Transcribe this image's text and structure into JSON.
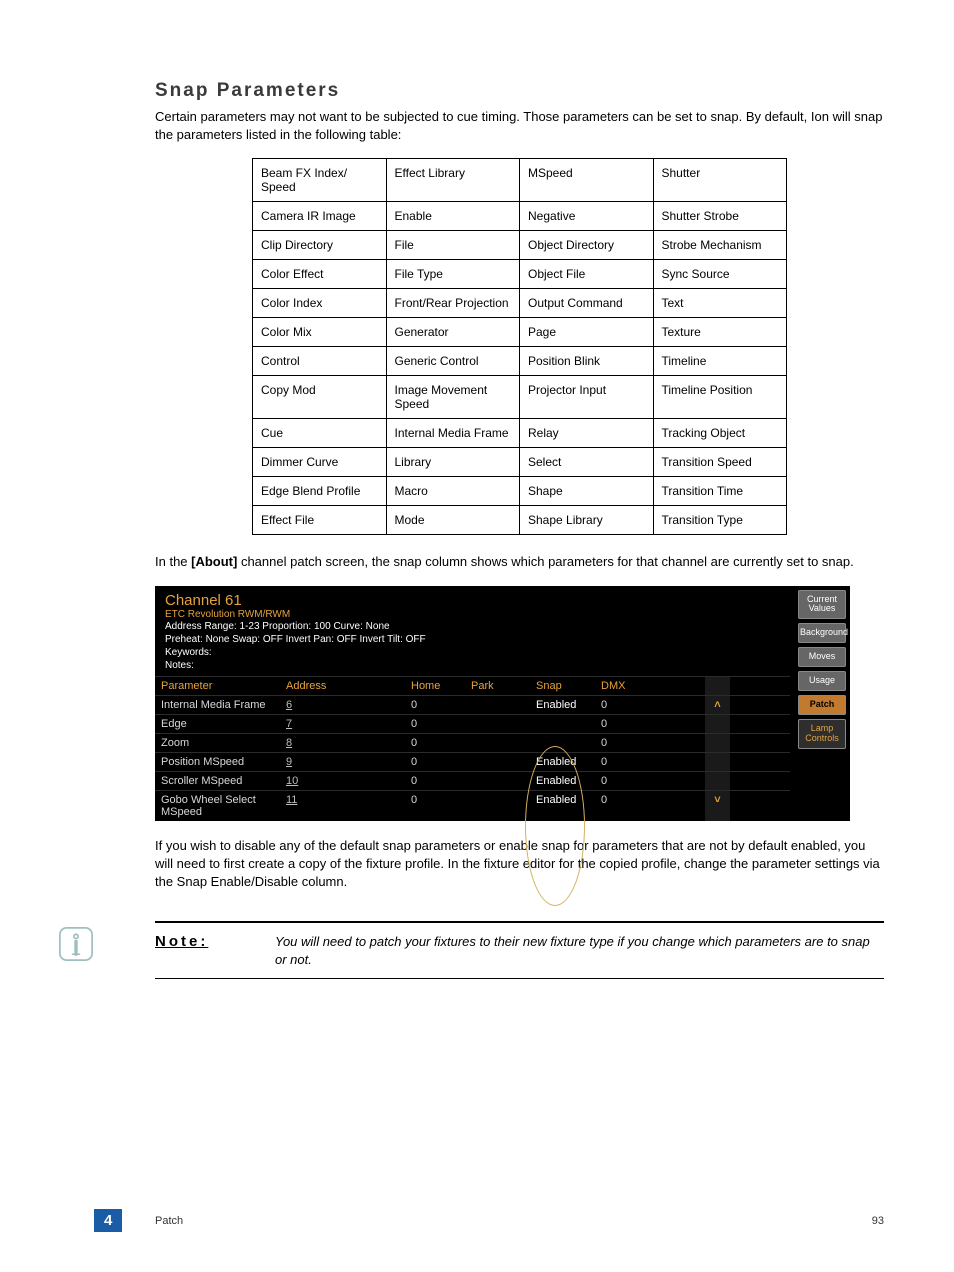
{
  "heading": "Snap Parameters",
  "intro": "Certain parameters may not want to be subjected to cue timing. Those parameters can be set to snap. By default, Ion will snap the parameters listed in the following table:",
  "snap_table": [
    [
      "Beam FX Index/ Speed",
      "Effect Library",
      "MSpeed",
      "Shutter"
    ],
    [
      "Camera IR Image",
      "Enable",
      "Negative",
      "Shutter Strobe"
    ],
    [
      "Clip Directory",
      "File",
      "Object Directory",
      "Strobe Mechanism"
    ],
    [
      "Color Effect",
      "File Type",
      "Object File",
      "Sync Source"
    ],
    [
      "Color Index",
      "Front/Rear Projection",
      "Output Command",
      "Text"
    ],
    [
      "Color Mix",
      "Generator",
      "Page",
      "Texture"
    ],
    [
      "Control",
      "Generic Control",
      "Position Blink",
      "Timeline"
    ],
    [
      "Copy Mod",
      "Image Movement Speed",
      "Projector Input",
      "Timeline Position"
    ],
    [
      "Cue",
      "Internal Media Frame",
      "Relay",
      "Tracking Object"
    ],
    [
      "Dimmer Curve",
      "Library",
      "Select",
      "Transition Speed"
    ],
    [
      "Edge Blend Profile",
      "Macro",
      "Shape",
      "Transition Time"
    ],
    [
      "Effect File",
      "Mode",
      "Shape Library",
      "Transition Type"
    ]
  ],
  "mid_text_pre": "In the ",
  "mid_text_bold": "[About]",
  "mid_text_post": " channel patch screen, the snap column shows which parameters for that channel are currently set to snap.",
  "screenshot": {
    "channel_title": "Channel 61",
    "fixture": "ETC Revolution RWM/RWM",
    "info_line1": "Address Range: 1-23   Proportion: 100   Curve: None",
    "info_line2": "Preheat: None   Swap: OFF   Invert Pan: OFF   Invert Tilt: OFF",
    "info_line3": "Keywords:",
    "info_line4": "Notes:",
    "headers": {
      "param": "Parameter",
      "address": "Address",
      "home": "Home",
      "park": "Park",
      "snap": "Snap",
      "dmx": "DMX"
    },
    "rows": [
      {
        "param": "Internal Media Frame",
        "address": "6",
        "home": "0",
        "park": "",
        "snap": "Enabled",
        "dmx": "0",
        "arrow": "˄"
      },
      {
        "param": "Edge",
        "address": "7",
        "home": "0",
        "park": "",
        "snap": "",
        "dmx": "0",
        "arrow": ""
      },
      {
        "param": "Zoom",
        "address": "8",
        "home": "0",
        "park": "",
        "snap": "",
        "dmx": "0",
        "arrow": ""
      },
      {
        "param": "Position MSpeed",
        "address": "9",
        "home": "0",
        "park": "",
        "snap": "Enabled",
        "dmx": "0",
        "arrow": ""
      },
      {
        "param": "Scroller MSpeed",
        "address": "10",
        "home": "0",
        "park": "",
        "snap": "Enabled",
        "dmx": "0",
        "arrow": ""
      },
      {
        "param": "Gobo Wheel Select MSpeed",
        "address": "11",
        "home": "0",
        "park": "",
        "snap": "Enabled",
        "dmx": "0",
        "arrow": "˅"
      }
    ],
    "side_tabs": [
      "Current Values",
      "Background",
      "Moves",
      "Usage",
      "Patch",
      "Lamp Controls"
    ]
  },
  "post_text": "If you wish to disable any of the default snap parameters or enable snap for parameters that are not by default enabled, you will need to first create a copy of the fixture profile. In the fixture editor for the copied profile, change the parameter settings via the Snap Enable/Disable column.",
  "note_label": "Note:",
  "note_text": "You will need to patch your fixtures to their new fixture type if you change which parameters are to snap or not.",
  "footer": {
    "chapter": "4",
    "section": "Patch",
    "page": "93"
  }
}
